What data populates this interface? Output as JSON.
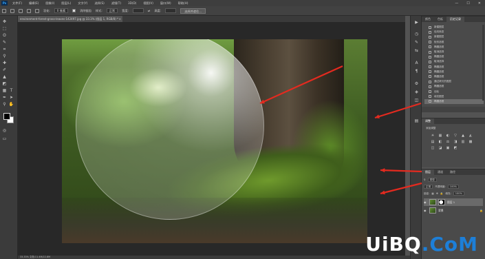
{
  "menubar": {
    "items": [
      "文件(F)",
      "编辑(E)",
      "图像(I)",
      "图层(L)",
      "文字(Y)",
      "选择(S)",
      "滤镜(T)",
      "3D(D)",
      "视图(V)",
      "窗口(W)",
      "帮助(H)"
    ],
    "window_controls": [
      "—",
      "☐",
      "✕"
    ]
  },
  "optionsbar": {
    "feather_label": "羽化:",
    "feather_value": "0 像素",
    "antialias_label": "消除锯齿",
    "style_label": "样式:",
    "style_value": "正常",
    "width_label": "宽度:",
    "height_label": "高度:",
    "select_mask_button": "选择并遮住..."
  },
  "document": {
    "tab_label": "environment-forest-grass-leaves-142497.jpg @ 33.3% (图层 1, RGB/8) *",
    "tab_close": "×"
  },
  "statusbar": {
    "text": "33.33%    文档:11.4M/22.8M"
  },
  "history_panel": {
    "tabs": [
      "颜色",
      "色板",
      "历史记录"
    ],
    "active_tab": 2,
    "items": [
      "新建图层",
      "径向渐变",
      "新建图层",
      "矩形选框",
      "椭圆选框",
      "取消选择",
      "椭圆选框",
      "取消选择",
      "椭圆选框",
      "椭圆选框",
      "椭圆选框",
      "通过拷贝的图层",
      "椭圆选框",
      "羽化",
      "填充图层",
      "椭圆选框"
    ],
    "selected_index": 15
  },
  "adjustments_panel": {
    "tab_label": "调整",
    "add_label": "添加调整",
    "icons": [
      "☀",
      "▦",
      "◐",
      "▽",
      "▲",
      "◭",
      "▤",
      "◧",
      "⚖",
      "◨",
      "▥",
      "▩",
      "◫",
      "◪",
      "▣",
      "◩"
    ]
  },
  "layers_panel": {
    "tabs": [
      "图层",
      "通道",
      "路径"
    ],
    "active_tab": 0,
    "kind_label": "类型",
    "blend_mode": "正常",
    "opacity_label": "不透明度:",
    "opacity_value": "100%",
    "lock_label": "锁定:",
    "fill_label": "填充:",
    "fill_value": "100%",
    "layers": [
      {
        "name": "图层 1",
        "visible": true,
        "selected": true
      },
      {
        "name": "背景",
        "visible": true,
        "selected": false,
        "locked": true
      }
    ]
  },
  "watermark": {
    "part1": "UiBQ",
    "part2": ".CoM"
  },
  "annotation_color": "#e42a1f"
}
